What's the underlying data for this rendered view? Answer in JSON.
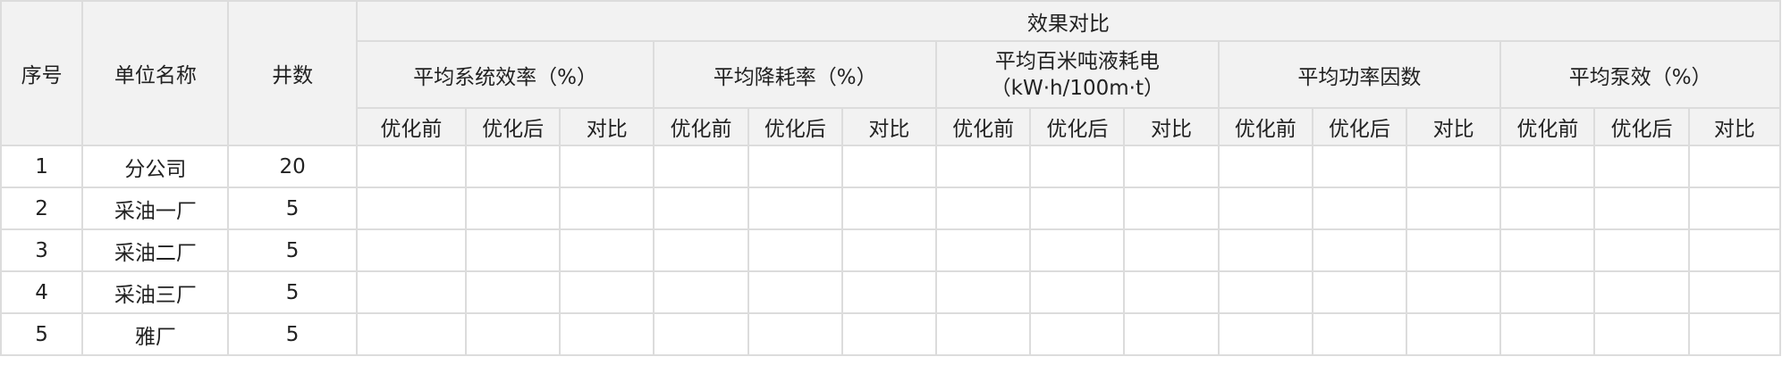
{
  "table": {
    "header_fixed": {
      "index": "序号",
      "unit_name": "单位名称",
      "well_count": "井数"
    },
    "header_group": "效果对比",
    "metrics": [
      {
        "label": "平均系统效率（%）"
      },
      {
        "label": "平均降耗率（%）"
      },
      {
        "label": "平均百米吨液耗电（kW·h/100m·t）"
      },
      {
        "label": "平均功率因数"
      },
      {
        "label": "平均泵效（%）"
      }
    ],
    "sub_headers": {
      "before": "优化前",
      "after": "优化后",
      "compare": "对比"
    },
    "rows": [
      {
        "index": "1",
        "unit": "分公司",
        "wells": "20"
      },
      {
        "index": "2",
        "unit": "采油一厂",
        "wells": "5"
      },
      {
        "index": "3",
        "unit": "采油二厂",
        "wells": "5"
      },
      {
        "index": "4",
        "unit": "采油三厂",
        "wells": "5"
      },
      {
        "index": "5",
        "unit": "雅厂",
        "wells": "5"
      }
    ]
  }
}
